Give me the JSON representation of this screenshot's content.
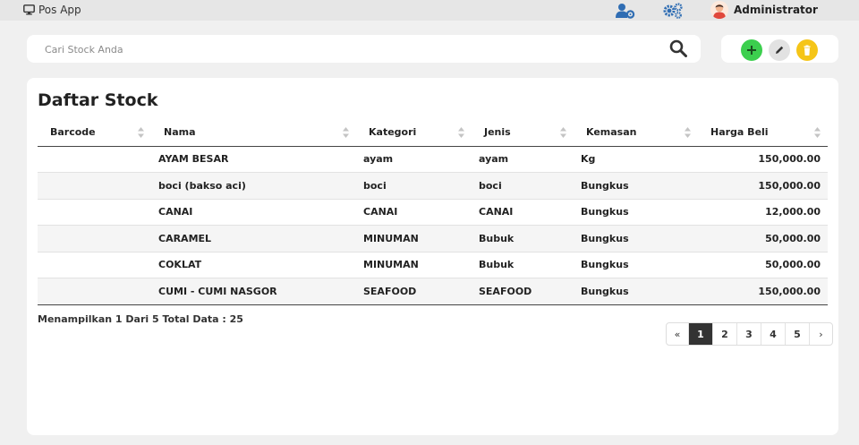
{
  "app": {
    "title": "Pos App",
    "user_name": "Administrator"
  },
  "search": {
    "placeholder": "Cari Stock Anda",
    "value": ""
  },
  "page": {
    "title": "Daftar Stock"
  },
  "table": {
    "columns": [
      "Barcode",
      "Nama",
      "Kategori",
      "Jenis",
      "Kemasan",
      "Harga Beli"
    ],
    "rows": [
      {
        "barcode": "",
        "nama": "AYAM BESAR",
        "kategori": "ayam",
        "jenis": "ayam",
        "kemasan": "Kg",
        "harga_beli": "150,000.00"
      },
      {
        "barcode": "",
        "nama": "boci (bakso aci)",
        "kategori": "boci",
        "jenis": "boci",
        "kemasan": "Bungkus",
        "harga_beli": "150,000.00"
      },
      {
        "barcode": "",
        "nama": "CANAI",
        "kategori": "CANAI",
        "jenis": "CANAI",
        "kemasan": "Bungkus",
        "harga_beli": "12,000.00"
      },
      {
        "barcode": "",
        "nama": "CARAMEL",
        "kategori": "MINUMAN",
        "jenis": "Bubuk",
        "kemasan": "Bungkus",
        "harga_beli": "50,000.00"
      },
      {
        "barcode": "",
        "nama": "COKLAT",
        "kategori": "MINUMAN",
        "jenis": "Bubuk",
        "kemasan": "Bungkus",
        "harga_beli": "50,000.00"
      },
      {
        "barcode": "",
        "nama": "CUMI - CUMI NASGOR",
        "kategori": "SEAFOOD",
        "jenis": "SEAFOOD",
        "kemasan": "Bungkus",
        "harga_beli": "150,000.00"
      }
    ]
  },
  "footer": {
    "info": "Menampilkan 1 Dari 5 Total Data : 25"
  },
  "pagination": {
    "prev": "«",
    "pages": [
      "1",
      "2",
      "3",
      "4",
      "5"
    ],
    "active": "1",
    "next": "›"
  },
  "icons": {
    "brand": "monitor-icon",
    "user_settings": "user-gear-icon",
    "settings": "gears-icon",
    "search": "search-icon",
    "add": "plus-icon",
    "edit": "pencil-icon",
    "delete": "trash-icon"
  },
  "colors": {
    "accent_blue": "#2f6db3",
    "add_green": "#3ccf4e",
    "delete_yellow": "#f5c518",
    "active_page": "#333333"
  }
}
